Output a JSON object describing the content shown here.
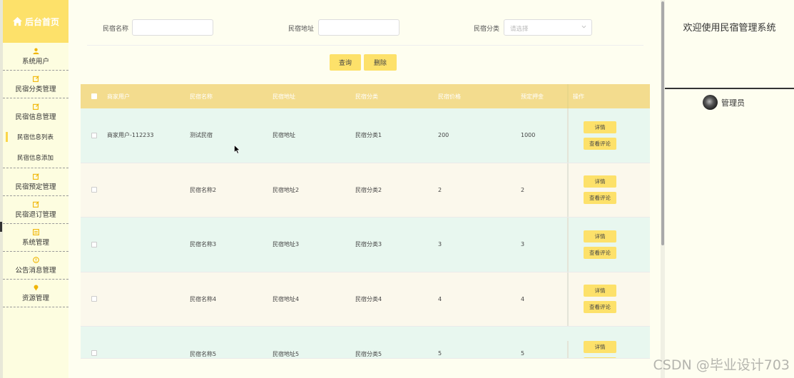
{
  "sidebar": {
    "home": "后台首页",
    "items": [
      {
        "label": "系统用户",
        "icon": "user-icon"
      },
      {
        "label": "民宿分类管理",
        "icon": "edit-icon"
      },
      {
        "label": "民宿信息管理",
        "icon": "edit-icon"
      }
    ],
    "sub_items": [
      "民宿信息列表",
      "民宿信息添加"
    ],
    "items2": [
      {
        "label": "民宿预定管理",
        "icon": "edit-icon"
      },
      {
        "label": "民宿退订管理",
        "icon": "edit-icon"
      },
      {
        "label": "系统管理",
        "icon": "grid-icon"
      },
      {
        "label": "公告消息管理",
        "icon": "info-icon"
      },
      {
        "label": "资源管理",
        "icon": "pin-icon"
      }
    ]
  },
  "search": {
    "name_label": "民宿名称",
    "address_label": "民宿地址",
    "category_label": "民宿分类",
    "category_placeholder": "请选择",
    "query_button": "查询",
    "delete_button": "删除"
  },
  "table": {
    "headers": [
      "商家用户",
      "民宿名称",
      "民宿地址",
      "民宿分类",
      "民宿价格",
      "预定押金",
      "操作"
    ],
    "rows": [
      {
        "merchant": "商家用户-112233",
        "name": "测试民宿",
        "address": "民宿地址",
        "category": "民宿分类1",
        "price": "200",
        "deposit": "1000"
      },
      {
        "merchant": "",
        "name": "民宿名称2",
        "address": "民宿地址2",
        "category": "民宿分类2",
        "price": "2",
        "deposit": "2"
      },
      {
        "merchant": "",
        "name": "民宿名称3",
        "address": "民宿地址3",
        "category": "民宿分类3",
        "price": "3",
        "deposit": "3"
      },
      {
        "merchant": "",
        "name": "民宿名称4",
        "address": "民宿地址4",
        "category": "民宿分类4",
        "price": "4",
        "deposit": "4"
      },
      {
        "merchant": "",
        "name": "民宿名称5",
        "address": "民宿地址5",
        "category": "民宿分类5",
        "price": "5",
        "deposit": "5"
      }
    ],
    "detail_button": "详情",
    "review_button": "查看评论"
  },
  "right_panel": {
    "welcome": "欢迎使用民宿管理系统",
    "admin_name": "管理员"
  },
  "watermark": "CSDN @毕业设计703",
  "colors": {
    "accent": "#fde16a",
    "sidebar_bg": "#fdfde0",
    "header_bg": "#f3dc8e",
    "row_green": "#e8f7ef",
    "row_cream": "#fbf8ec"
  }
}
